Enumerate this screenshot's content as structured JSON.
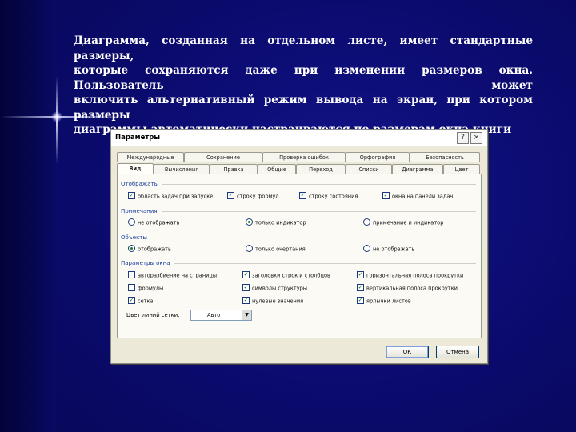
{
  "slide": {
    "lines": [
      "Диаграмма, созданная на отдельном листе, имеет стандартные размеры,",
      "которые сохраняются даже при изменении размеров окна. Пользователь может",
      "включить альтернативный режим вывода на экран, при котором размеры",
      "диаграммы автоматически настраиваются по размерам окна книги"
    ]
  },
  "dialog": {
    "title": "Параметры",
    "help_icon": "?",
    "close_icon": "×",
    "tabs_top": [
      "Международные",
      "Сохранение",
      "Проверка ошибок",
      "Орфография",
      "Безопасность"
    ],
    "tabs_bottom": [
      "Вид",
      "Вычисления",
      "Правка",
      "Общие",
      "Переход",
      "Списки",
      "Диаграмма",
      "Цвет"
    ],
    "active_tab": "Вид",
    "groups": {
      "show": {
        "label": "Отображать",
        "options": [
          {
            "label": "область задач при запуске",
            "checked": true
          },
          {
            "label": "строку формул",
            "checked": true
          },
          {
            "label": "строку состояния",
            "checked": true
          },
          {
            "label": "окна на панели задач",
            "checked": true
          }
        ]
      },
      "notes": {
        "label": "Примечания",
        "options": [
          {
            "label": "не отображать",
            "selected": false
          },
          {
            "label": "только индикатор",
            "selected": true
          },
          {
            "label": "примечание и индикатор",
            "selected": false
          }
        ]
      },
      "objects": {
        "label": "Объекты",
        "options": [
          {
            "label": "отображать",
            "selected": true
          },
          {
            "label": "только очертания",
            "selected": false
          },
          {
            "label": "не отображать",
            "selected": false
          }
        ]
      },
      "window": {
        "label": "Параметры окна",
        "col1": [
          {
            "label": "авторазбиение на страницы",
            "checked": false
          },
          {
            "label": "формулы",
            "checked": false
          },
          {
            "label": "сетка",
            "checked": true
          }
        ],
        "col2": [
          {
            "label": "заголовки строк и столбцов",
            "checked": true
          },
          {
            "label": "символы структуры",
            "checked": true
          },
          {
            "label": "нулевые значения",
            "checked": true
          }
        ],
        "col3": [
          {
            "label": "горизонтальная полоса прокрутки",
            "checked": true
          },
          {
            "label": "вертикальная полоса прокрутки",
            "checked": true
          },
          {
            "label": "ярлычки листов",
            "checked": true
          }
        ]
      }
    },
    "gridline_color": {
      "label": "Цвет линий сетки:",
      "value": "Авто"
    },
    "ok_label": "ОК",
    "cancel_label": "Отмена",
    "check_mark": "✓",
    "colors": {
      "background": "#0b0b6e",
      "dialog": "#ece9d8",
      "group_label": "#1a3fa0"
    }
  }
}
